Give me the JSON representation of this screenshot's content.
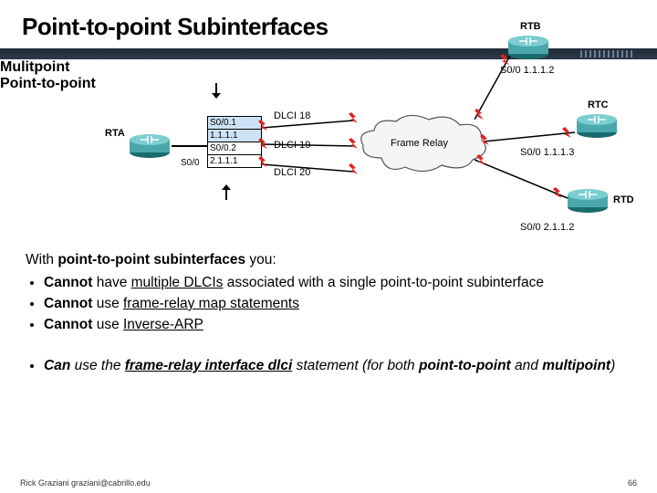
{
  "title": "Point-to-point Subinterfaces",
  "diagram": {
    "annot_multipoint": "Mulitpoint",
    "annot_p2p": "Point-to-point",
    "routers": {
      "rta": "RTA",
      "rtb": "RTB",
      "rtc": "RTC",
      "rtd": "RTD"
    },
    "rta_interface_label": "S0/0",
    "subif_box": {
      "r1a": "S0/0.1",
      "r1b": "1.1.1.1",
      "r2a": "S0/0.2",
      "r2b": "2.1.1.1"
    },
    "dlci": {
      "d18": "DLCI 18",
      "d19": "DLCI 19",
      "d20": "DLCI 20"
    },
    "cloud_label": "Frame Relay",
    "remote_ifs": {
      "rtb": "S0/0 1.1.1.2",
      "rtc": "S0/0 1.1.1.3",
      "rtd": "S0/0 2.1.1.2"
    }
  },
  "text": {
    "intro_prefix": "With ",
    "intro_bold": "point-to-point subinterfaces",
    "intro_suffix": " you:",
    "b1_a": "Cannot",
    "b1_mid": " have ",
    "b1_u": "multiple DLCIs",
    "b1_end": " associated with a single point-to-point subinterface",
    "b2_a": "Cannot",
    "b2_mid": " use ",
    "b2_u": "frame-relay map statements",
    "b3_a": "Cannot",
    "b3_mid": " use ",
    "b3_u": "Inverse-ARP",
    "b4_a": "Can",
    "b4_mid": " use the ",
    "b4_u": "frame-relay interface dlci",
    "b4_after": " statement (for both ",
    "b4_p2p": "point-to-point",
    "b4_and": " and ",
    "b4_mp": "multipoint",
    "b4_close": ")"
  },
  "footer": {
    "left": "Rick Graziani  graziani@cabrillo.edu",
    "right": "66"
  }
}
